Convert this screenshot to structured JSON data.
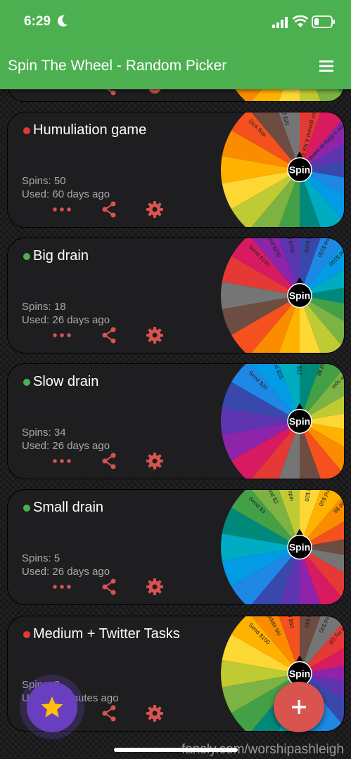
{
  "status_bar": {
    "time": "6:29"
  },
  "app_bar": {
    "title": "Spin The Wheel - Random Picker"
  },
  "wheel_button_label": "Spin",
  "cards": [
    {
      "title": "Humuliation game",
      "status_color": "#e53935",
      "spins": "Spins: 50",
      "used": "Used: 60 days ago",
      "wheel_labels": [
        "Dick flick",
        "Send $20",
        "Spit on ground & lick it up",
        "Waste a thing to waste"
      ]
    },
    {
      "title": "Big drain",
      "status_color": "#4caf50",
      "spins": "Spins: 18",
      "used": "Used: 26 days ago",
      "wheel_labels": [
        "Send $100",
        "Send $250",
        "Send $700",
        "Send $200",
        "Send $150",
        "Send $100"
      ]
    },
    {
      "title": "Slow drain",
      "status_color": "#4caf50",
      "spins": "Spins: 34",
      "used": "Used: 26 days ago",
      "wheel_labels": [
        "Send $20",
        "Send $15",
        "Send $12",
        "Send $8",
        "Free spin"
      ]
    },
    {
      "title": "Small drain",
      "status_color": "#4caf50",
      "spins": "Spins: 5",
      "used": "Used: 26 days ago",
      "wheel_labels": [
        "Send $3",
        "Send $2",
        "Free spin",
        "Send $20",
        "Send $10",
        "Send $8"
      ]
    },
    {
      "title": "Medium + Twitter Tasks",
      "status_color": "#e53935",
      "spins": "Spins: 8",
      "used": "Used: 5 minutes ago",
      "wheel_labels": [
        "Send $100",
        "Update bio",
        "Send $50",
        "Send $40",
        "Send $30",
        "Sub my OF"
      ]
    }
  ],
  "wheel_colors": [
    "#e53935",
    "#d81b60",
    "#8e24aa",
    "#5e35b1",
    "#3949ab",
    "#1e88e5",
    "#039be5",
    "#00acc1",
    "#00897b",
    "#43a047",
    "#7cb342",
    "#c0ca33",
    "#fdd835",
    "#ffb300",
    "#fb8c00",
    "#f4511e",
    "#6d4c41",
    "#757575"
  ],
  "fab": {
    "favorite_icon": "star-icon",
    "add_icon": "plus-icon"
  },
  "watermark": "fansly.com/worshipashleigh"
}
